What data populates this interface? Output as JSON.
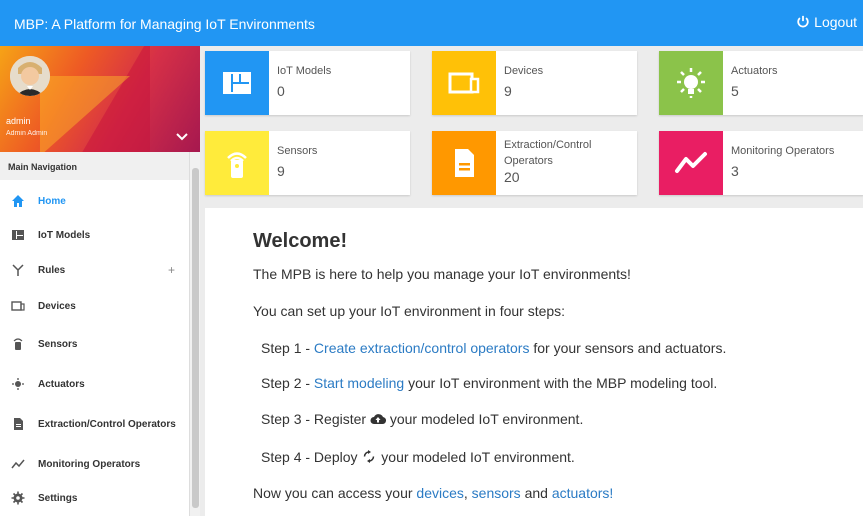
{
  "app": {
    "title": "MBP: A Platform for Managing IoT Environments",
    "logout": "Logout"
  },
  "profile": {
    "name": "admin",
    "subname": "Admin Admin"
  },
  "nav": {
    "heading": "Main Navigation",
    "items": [
      {
        "label": "Home",
        "icon": "home-icon"
      },
      {
        "label": "IoT Models",
        "icon": "models-icon"
      },
      {
        "label": "Rules",
        "icon": "rules-icon",
        "expand": "+"
      },
      {
        "label": "Devices",
        "icon": "devices-icon"
      },
      {
        "label": "Sensors",
        "icon": "sensor-icon"
      },
      {
        "label": "Actuators",
        "icon": "actuator-icon"
      },
      {
        "label": "Extraction/Control Operators",
        "icon": "file-icon"
      },
      {
        "label": "Monitoring Operators",
        "icon": "chart-line-icon"
      },
      {
        "label": "Settings",
        "icon": "gear-icon"
      }
    ]
  },
  "cards": [
    {
      "label": "IoT Models",
      "value": "0",
      "color": "#2196f3"
    },
    {
      "label": "Devices",
      "value": "9",
      "color": "#ffc107"
    },
    {
      "label": "Actuators",
      "value": "5",
      "color": "#8bc34a"
    },
    {
      "label": "Sensors",
      "value": "9",
      "color": "#ffeb3b"
    },
    {
      "label": "Extraction/Control Operators",
      "value": "20",
      "color": "#ff9800"
    },
    {
      "label": "Monitoring Operators",
      "value": "3",
      "color": "#e91e63"
    }
  ],
  "welcome": {
    "title": "Welcome!",
    "intro": "The MPB is here to help you manage your IoT environments!",
    "setup": "You can set up your IoT environment in four steps:",
    "step1_prefix": "Step 1 - ",
    "step1_link": "Create extraction/control operators",
    "step1_suffix": " for your sensors and actuators.",
    "step2_prefix": "Step 2 - ",
    "step2_link": "Start modeling",
    "step2_suffix": " your IoT environment with the MBP modeling tool.",
    "step3_prefix": "Step 3 - Register ",
    "step3_suffix": " your modeled IoT environment.",
    "step4_prefix": "Step 4 - Deploy ",
    "step4_suffix": " your modeled IoT environment.",
    "access_prefix": "Now you can access your ",
    "access_link1": "devices",
    "access_sep1": ", ",
    "access_link2": "sensors",
    "access_sep2": " and ",
    "access_link3": "actuators!"
  }
}
